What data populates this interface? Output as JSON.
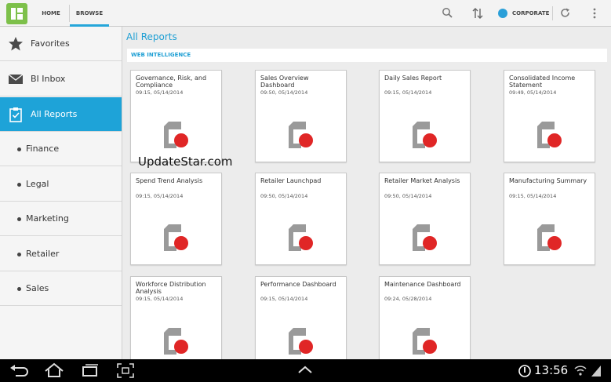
{
  "topbar": {
    "tabs": [
      {
        "label": "HOME"
      },
      {
        "label": "BROWSE"
      }
    ],
    "corporate_label": "CORPORATE",
    "accent_color": "#25a6d9"
  },
  "sidebar": {
    "items": [
      {
        "label": "Favorites",
        "icon": "star-icon"
      },
      {
        "label": "BI Inbox",
        "icon": "envelope-icon"
      },
      {
        "label": "All Reports",
        "icon": "clipboard-icon",
        "active": true
      }
    ],
    "subitems": [
      {
        "label": "Finance"
      },
      {
        "label": "Legal"
      },
      {
        "label": "Marketing"
      },
      {
        "label": "Retailer"
      },
      {
        "label": "Sales"
      }
    ]
  },
  "main": {
    "title": "All Reports",
    "section": "WEB INTELLIGENCE",
    "reports": [
      {
        "title": "Governance, Risk, and Compliance",
        "date": "09:15, 05/14/2014"
      },
      {
        "title": "Sales Overview Dashboard",
        "date": "09:50, 05/14/2014"
      },
      {
        "title": "Daily Sales Report",
        "date": "09:15, 05/14/2014"
      },
      {
        "title": "Consolidated Income Statement",
        "date": "09:49, 05/14/2014"
      },
      {
        "title": "Spend Trend Analysis",
        "date": "09:15, 05/14/2014"
      },
      {
        "title": "Retailer Launchpad",
        "date": "09:50, 05/14/2014"
      },
      {
        "title": "Retailer Market Analysis",
        "date": "09:50, 05/14/2014"
      },
      {
        "title": "Manufacturing Summary",
        "date": "09:15, 05/14/2014"
      },
      {
        "title": "Workforce Distribution Analysis",
        "date": "09:15, 05/14/2014"
      },
      {
        "title": "Performance Dashboard",
        "date": "09:15, 05/14/2014"
      },
      {
        "title": "Maintenance Dashboard",
        "date": "09:24, 05/28/2014"
      }
    ]
  },
  "watermark": "UpdateStar.com",
  "statusbar": {
    "time": "13:56"
  }
}
